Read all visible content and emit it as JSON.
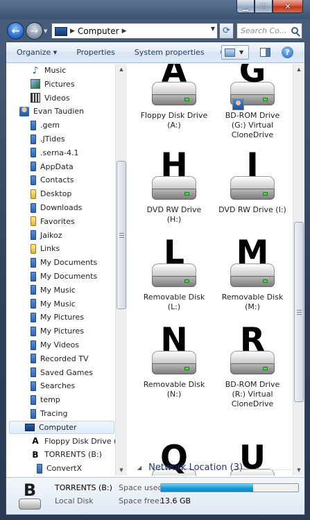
{
  "window": {
    "caption_buttons": [
      "minimize-icon",
      "maximize-icon",
      "close-icon"
    ]
  },
  "nav": {
    "breadcrumb": [
      "Computer"
    ],
    "search_placeholder": "Search Co..."
  },
  "toolbar": {
    "organize": "Organize ▾",
    "properties": "Properties",
    "system_properties": "System properties",
    "more": "»"
  },
  "tree": [
    {
      "label": "Music",
      "icon": "music-icon"
    },
    {
      "label": "Pictures",
      "icon": "pictures-icon"
    },
    {
      "label": "Videos",
      "icon": "videos-icon"
    },
    {
      "label": "Evan Taudien",
      "icon": "user-icon"
    },
    {
      "label": ".gem",
      "icon": "folder-icon"
    },
    {
      "label": ".JTides",
      "icon": "folder-icon"
    },
    {
      "label": ".serna-4.1",
      "icon": "folder-icon"
    },
    {
      "label": "AppData",
      "icon": "folder-icon"
    },
    {
      "label": "Contacts",
      "icon": "folder-icon"
    },
    {
      "label": "Desktop",
      "icon": "folder-icon"
    },
    {
      "label": "Downloads",
      "icon": "folder-icon"
    },
    {
      "label": "Favorites",
      "icon": "folder-icon"
    },
    {
      "label": "Jaikoz",
      "icon": "folder-icon"
    },
    {
      "label": "Links",
      "icon": "folder-icon"
    },
    {
      "label": "My Documents",
      "icon": "folder-icon"
    },
    {
      "label": "My Documents",
      "icon": "folder-icon"
    },
    {
      "label": "My Music",
      "icon": "folder-icon"
    },
    {
      "label": "My Music",
      "icon": "folder-icon"
    },
    {
      "label": "My Pictures",
      "icon": "folder-icon"
    },
    {
      "label": "My Pictures",
      "icon": "folder-icon"
    },
    {
      "label": "My Videos",
      "icon": "folder-icon"
    },
    {
      "label": "Recorded TV",
      "icon": "folder-icon"
    },
    {
      "label": "Saved Games",
      "icon": "folder-icon"
    },
    {
      "label": "Searches",
      "icon": "folder-icon"
    },
    {
      "label": "temp",
      "icon": "folder-icon"
    },
    {
      "label": "Tracing",
      "icon": "folder-icon"
    },
    {
      "label": "Computer",
      "icon": "computer-icon"
    },
    {
      "label": "Floppy Disk Drive (A",
      "icon": "floppy-drive-icon"
    },
    {
      "label": "TORRENTS (B:)",
      "icon": "drive-icon"
    },
    {
      "label": "ConvertX",
      "icon": "folder-icon"
    }
  ],
  "drives": [
    {
      "letter": "A",
      "line1": "Floppy Disk Drive",
      "line2": "(A:)",
      "line3": ""
    },
    {
      "letter": "G",
      "line1": "BD-ROM Drive",
      "line2": "(G:) Virtual",
      "line3": "CloneDrive"
    },
    {
      "letter": "H",
      "line1": "DVD RW Drive",
      "line2": "(H:)",
      "line3": ""
    },
    {
      "letter": "I",
      "line1": "DVD RW Drive (I:)",
      "line2": "",
      "line3": ""
    },
    {
      "letter": "L",
      "line1": "Removable Disk",
      "line2": "(L:)",
      "line3": ""
    },
    {
      "letter": "M",
      "line1": "Removable Disk",
      "line2": "(M:)",
      "line3": ""
    },
    {
      "letter": "N",
      "line1": "Removable Disk",
      "line2": "(N:)",
      "line3": ""
    },
    {
      "letter": "R",
      "line1": "BD-ROM Drive",
      "line2": "(R:) Virtual",
      "line3": "CloneDrive"
    },
    {
      "letter": "Q",
      "line1": "",
      "line2": "",
      "line3": ""
    },
    {
      "letter": "U",
      "line1": "",
      "line2": "",
      "line3": ""
    }
  ],
  "group": {
    "label": "Network Location (3)"
  },
  "details": {
    "letter": "B",
    "name": "TORRENTS (B:)",
    "type": "Local Disk",
    "space_used_label": "Space used:",
    "space_free_label": "Space free:",
    "space_free": "13.6 GB",
    "space_used_fraction": 0.67
  },
  "colors": {
    "accent": "#1e3287",
    "usage_bar": "#1aa0d8",
    "drive_led": "#3fe23a"
  }
}
